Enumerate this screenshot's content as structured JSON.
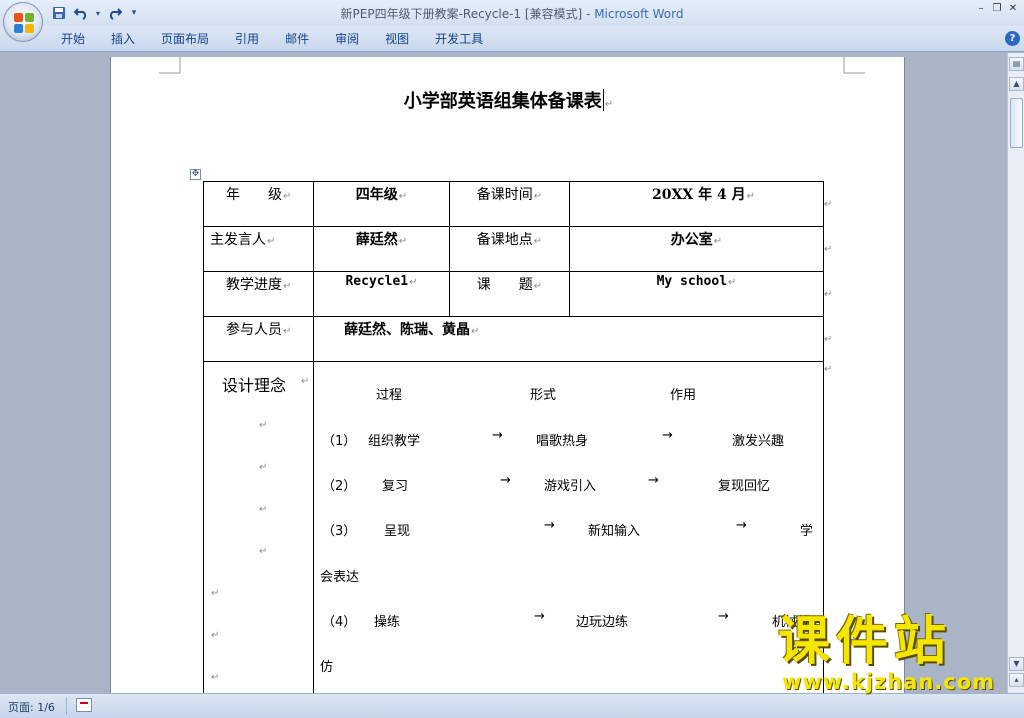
{
  "window": {
    "title_doc": "新PEP四年级下册教案-Recycle-1 [兼容模式] - ",
    "title_app": "Microsoft Word",
    "minimize": "–",
    "restore": "❐",
    "close": "✕"
  },
  "quick_access": {
    "save_icon": "save-icon",
    "undo_icon": "undo-icon",
    "redo_icon": "redo-icon",
    "customize_icon": "customize-icon"
  },
  "ribbon": {
    "tabs": [
      "开始",
      "插入",
      "页面布局",
      "引用",
      "邮件",
      "审阅",
      "视图",
      "开发工具"
    ],
    "help_label": "?"
  },
  "document": {
    "title": "小学部英语组集体备课表",
    "table": {
      "grade_label": "年　　级",
      "grade_value": "四年级",
      "time_label": "备课时间",
      "time_value": "20XX 年 4 月",
      "speaker_label": "主发言人",
      "speaker_value": "薛廷然",
      "place_label": "备课地点",
      "place_value": "办公室",
      "progress_label": "教学进度",
      "progress_value": "Recycle1",
      "topic_label": "课　　题",
      "topic_value": "My school",
      "participants_label": "参与人员",
      "participants_value": "薛廷然、陈瑞、黄晶",
      "design_label": "设计理念",
      "process_header": {
        "process": "过程",
        "form": "形式",
        "effect": "作用"
      },
      "steps": [
        {
          "num": "（1）",
          "process": "组织教学",
          "form": "唱歌热身",
          "effect": "激发兴趣"
        },
        {
          "num": "（2）",
          "process": "复习",
          "form": "游戏引入",
          "effect": "复现回忆"
        },
        {
          "num": "（3）",
          "process": "呈现",
          "form": "新知输入",
          "effect": "学",
          "effect_wrap": "会表达"
        },
        {
          "num": "（4）",
          "process": "操练",
          "form": "边玩边练",
          "effect": "机械模",
          "effect_wrap": "仿"
        }
      ],
      "arrow": "→"
    }
  },
  "status": {
    "page": "页面: 1/6"
  },
  "watermark": {
    "brand": "课件站",
    "url": "www.kjzhan.com"
  }
}
